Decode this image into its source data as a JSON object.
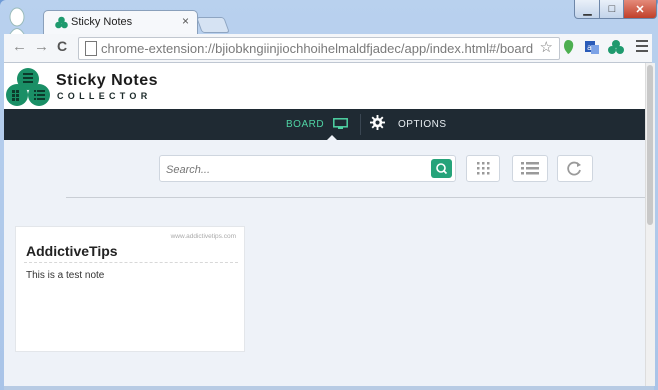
{
  "browser": {
    "tab_title": "Sticky Notes",
    "tab_close": "×",
    "url": "chrome-extension://bjiobkngiinjiochhoihelmaldfjadec/app/index.html#/board",
    "back": "←",
    "forward": "→",
    "reload": "C",
    "star": "☆"
  },
  "app": {
    "title": "Sticky Notes",
    "subtitle": "COLLECTOR",
    "nav": {
      "board": "BOARD",
      "options": "OPTIONS"
    },
    "search": {
      "placeholder": "Search..."
    }
  },
  "notes": [
    {
      "watermark": "www.addictivetips.com",
      "title": "AddictiveTips",
      "body": "This is a test note"
    }
  ],
  "colors": {
    "accent": "#25a37a",
    "nav_bg": "#1f2a33",
    "nav_active": "#4fd3a4"
  }
}
